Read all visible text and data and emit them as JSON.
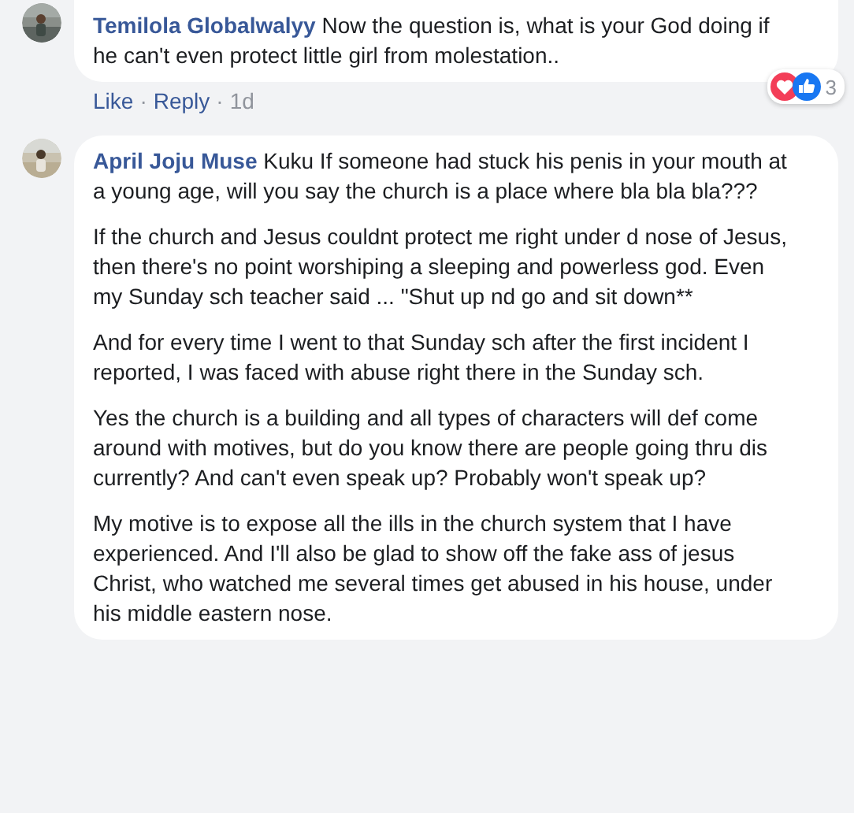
{
  "comments": [
    {
      "author": "Temilola Globalwalyy",
      "paragraphs": [
        "Now the question is, what is your God doing if he can't even protect little girl from molestation.."
      ],
      "actions": [
        "Like",
        "Reply"
      ],
      "separator": "·",
      "time": "1d",
      "reaction_count": "3"
    },
    {
      "author": "April Joju Muse",
      "paragraphs": [
        "Kuku If someone had stuck his penis in your mouth at a young age, will you say the church is a place where bla bla bla???",
        "If the church and Jesus couldnt protect me right under d nose of Jesus, then there's no point worshiping a sleeping and powerless god. Even my Sunday sch teacher said ... \"Shut up nd go and sit down**",
        "And for every time I went to that Sunday sch after the first incident I reported, I was faced with abuse right there in the Sunday sch.",
        "Yes the church is a building and all types of characters will def come around with motives, but do you know there are people going thru dis currently? And can't even speak up? Probably won't speak up?",
        "My motive is to expose all the ills in the church system that I have experienced. And I'll also be glad to show off the fake ass of jesus Christ, who watched me several times get abused in his house, under his middle eastern nose."
      ]
    }
  ]
}
